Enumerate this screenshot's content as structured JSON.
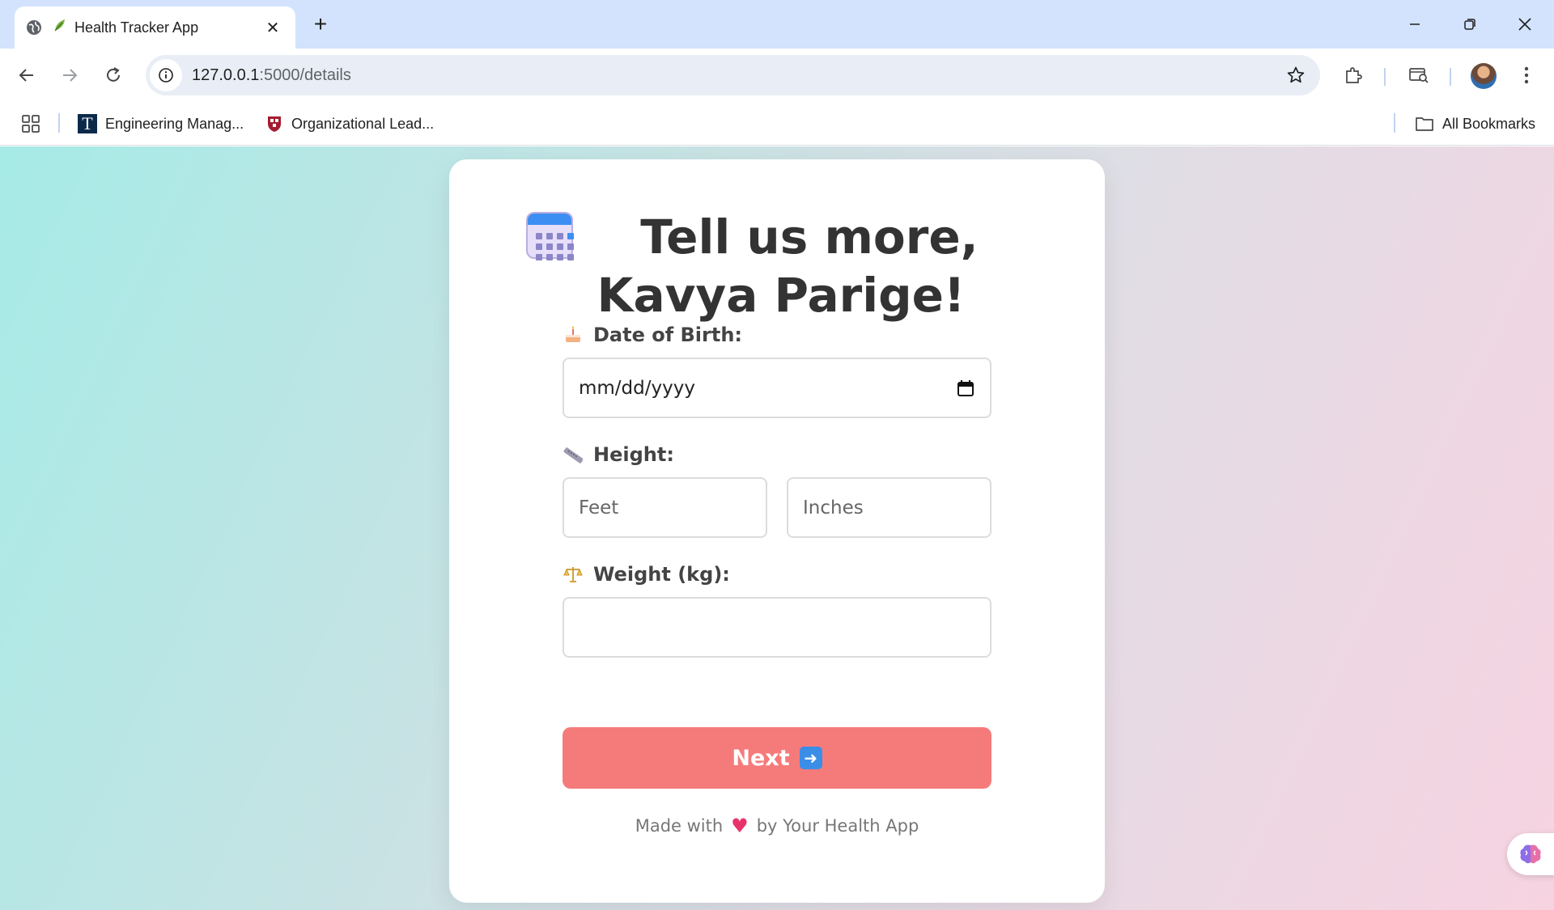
{
  "browser": {
    "tab_title": "Health Tracker App",
    "tab_favicon": "leaf-icon",
    "url_host": "127.0.0.1",
    "url_path": ":5000/details",
    "bookmarks": [
      {
        "label": "Engineering Manag...",
        "icon": "t-logo-icon"
      },
      {
        "label": "Organizational Lead...",
        "icon": "harvard-shield-icon"
      }
    ],
    "all_bookmarks_label": "All Bookmarks"
  },
  "page": {
    "heading": "Tell us more, Kavya Parige!",
    "heading_icon": "calendar-icon",
    "dob": {
      "label": "Date of Birth:",
      "icon": "birthday-cake-icon",
      "placeholder": "mm/dd/yyyy"
    },
    "height": {
      "label": "Height:",
      "icon": "ruler-icon",
      "feet_placeholder": "Feet",
      "inches_placeholder": "Inches"
    },
    "weight": {
      "label": "Weight (kg):",
      "icon": "balance-scale-icon",
      "value": ""
    },
    "next_button": {
      "label": "Next",
      "icon": "right-arrow-icon"
    },
    "footer": {
      "prefix": "Made with",
      "suffix": "by Your Health App",
      "icon": "heart-icon"
    }
  },
  "colors": {
    "accent_button": "#f57b7b",
    "tabstrip": "#d3e3fd",
    "heading_text": "#333333"
  }
}
